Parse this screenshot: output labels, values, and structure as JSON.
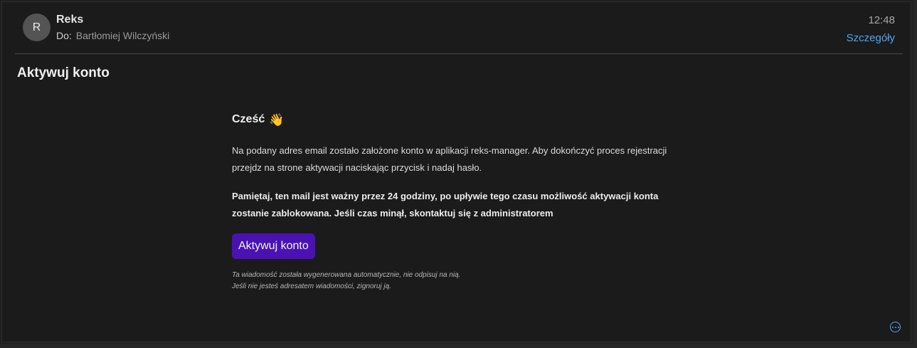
{
  "message": {
    "avatar_initial": "R",
    "sender": "Reks",
    "recipient_prefix": "Do:",
    "recipient": "Bartłomiej Wilczyński",
    "time": "12:48",
    "details_label": "Szczegóły",
    "subject": "Aktywuj konto"
  },
  "email": {
    "greeting": "Cześć",
    "greeting_emoji": "👋",
    "paragraph": "Na podany adres email zostało założone konto w aplikacji reks-manager. Aby dokończyć proces rejestracji przejdz na strone aktywacji naciskając przycisk i nadaj hasło.",
    "warning": "Pamiętaj, ten mail jest ważny przez 24 godziny, po upływie tego czasu możliwość aktywacji konta zostanie zablokowana. Jeśli czas minął, skontaktuj się z administratorem",
    "button_label": "Aktywuj konto",
    "footer_line1": "Ta wiadomość została wygenerowana automatycznie, nie odpisuj na nią.",
    "footer_line2": "Jeśli nie jesteś adresatem wiadomości, zignoruj ją."
  },
  "icons": {
    "more": "more-options-icon"
  },
  "colors": {
    "accent_link": "#4ea6f2",
    "button": "#4a12b4"
  }
}
